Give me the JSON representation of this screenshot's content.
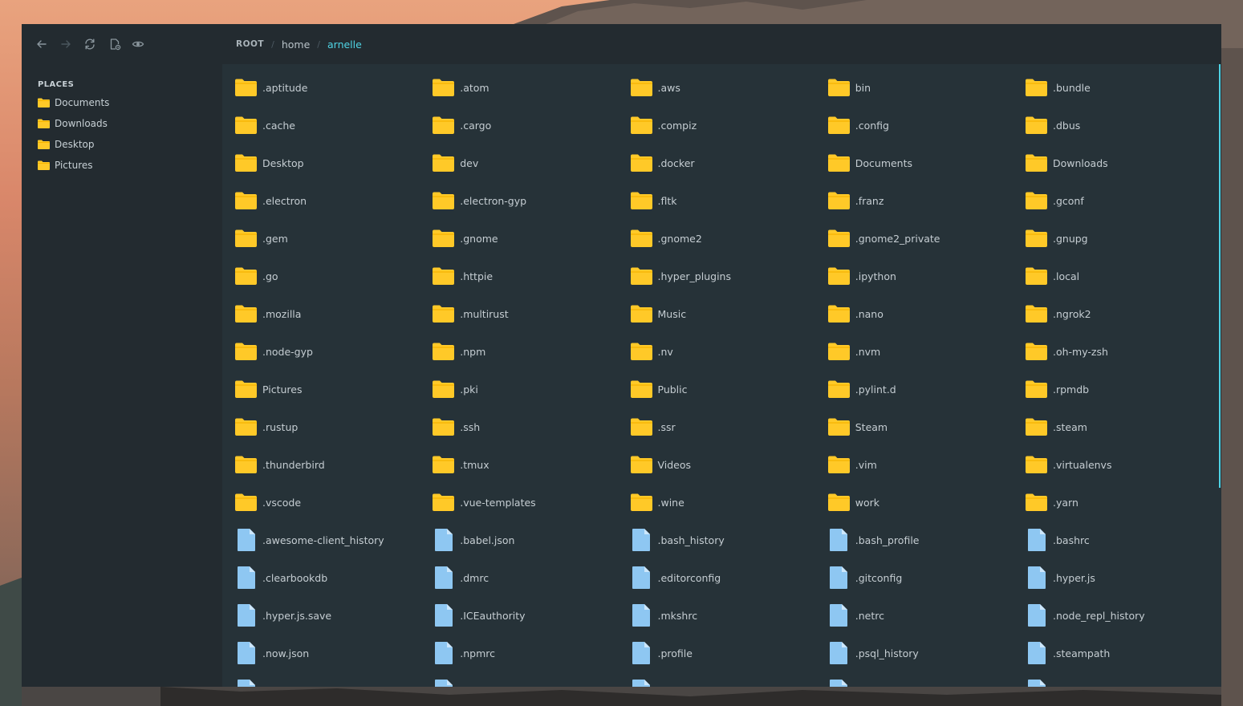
{
  "toolbar": {
    "buttons": [
      {
        "name": "back-button",
        "icon": "arrow-left-icon"
      },
      {
        "name": "forward-button",
        "icon": "arrow-right-icon"
      },
      {
        "name": "refresh-button",
        "icon": "refresh-icon"
      },
      {
        "name": "new-file-button",
        "icon": "new-file-icon"
      },
      {
        "name": "toggle-hidden-button",
        "icon": "eye-icon"
      }
    ]
  },
  "breadcrumb": {
    "root": "ROOT",
    "home": "home",
    "current": "arnelle"
  },
  "sidebar": {
    "title": "PLACES",
    "items": [
      {
        "label": "Documents"
      },
      {
        "label": "Downloads"
      },
      {
        "label": "Desktop"
      },
      {
        "label": "Pictures"
      }
    ]
  },
  "colors": {
    "folder": "#ffc928",
    "folder_tab": "#f5b300",
    "file": "#8ec7f2",
    "file_fold": "#cde7fb",
    "accent": "#4fd3e4",
    "panel_bg": "#263238",
    "sidebar_bg": "#232b30"
  },
  "items": [
    {
      "name": ".aptitude",
      "type": "folder"
    },
    {
      "name": ".atom",
      "type": "folder"
    },
    {
      "name": ".aws",
      "type": "folder"
    },
    {
      "name": "bin",
      "type": "folder"
    },
    {
      "name": ".bundle",
      "type": "folder"
    },
    {
      "name": ".cache",
      "type": "folder"
    },
    {
      "name": ".cargo",
      "type": "folder"
    },
    {
      "name": ".compiz",
      "type": "folder"
    },
    {
      "name": ".config",
      "type": "folder"
    },
    {
      "name": ".dbus",
      "type": "folder"
    },
    {
      "name": "Desktop",
      "type": "folder"
    },
    {
      "name": "dev",
      "type": "folder"
    },
    {
      "name": ".docker",
      "type": "folder"
    },
    {
      "name": "Documents",
      "type": "folder"
    },
    {
      "name": "Downloads",
      "type": "folder"
    },
    {
      "name": ".electron",
      "type": "folder"
    },
    {
      "name": ".electron-gyp",
      "type": "folder"
    },
    {
      "name": ".fltk",
      "type": "folder"
    },
    {
      "name": ".franz",
      "type": "folder"
    },
    {
      "name": ".gconf",
      "type": "folder"
    },
    {
      "name": ".gem",
      "type": "folder"
    },
    {
      "name": ".gnome",
      "type": "folder"
    },
    {
      "name": ".gnome2",
      "type": "folder"
    },
    {
      "name": ".gnome2_private",
      "type": "folder"
    },
    {
      "name": ".gnupg",
      "type": "folder"
    },
    {
      "name": ".go",
      "type": "folder"
    },
    {
      "name": ".httpie",
      "type": "folder"
    },
    {
      "name": ".hyper_plugins",
      "type": "folder"
    },
    {
      "name": ".ipython",
      "type": "folder"
    },
    {
      "name": ".local",
      "type": "folder"
    },
    {
      "name": ".mozilla",
      "type": "folder"
    },
    {
      "name": ".multirust",
      "type": "folder"
    },
    {
      "name": "Music",
      "type": "folder"
    },
    {
      "name": ".nano",
      "type": "folder"
    },
    {
      "name": ".ngrok2",
      "type": "folder"
    },
    {
      "name": ".node-gyp",
      "type": "folder"
    },
    {
      "name": ".npm",
      "type": "folder"
    },
    {
      "name": ".nv",
      "type": "folder"
    },
    {
      "name": ".nvm",
      "type": "folder"
    },
    {
      "name": ".oh-my-zsh",
      "type": "folder"
    },
    {
      "name": "Pictures",
      "type": "folder"
    },
    {
      "name": ".pki",
      "type": "folder"
    },
    {
      "name": "Public",
      "type": "folder"
    },
    {
      "name": ".pylint.d",
      "type": "folder"
    },
    {
      "name": ".rpmdb",
      "type": "folder"
    },
    {
      "name": ".rustup",
      "type": "folder"
    },
    {
      "name": ".ssh",
      "type": "folder"
    },
    {
      "name": ".ssr",
      "type": "folder"
    },
    {
      "name": "Steam",
      "type": "folder"
    },
    {
      "name": ".steam",
      "type": "folder"
    },
    {
      "name": ".thunderbird",
      "type": "folder"
    },
    {
      "name": ".tmux",
      "type": "folder"
    },
    {
      "name": "Videos",
      "type": "folder"
    },
    {
      "name": ".vim",
      "type": "folder"
    },
    {
      "name": ".virtualenvs",
      "type": "folder"
    },
    {
      "name": ".vscode",
      "type": "folder"
    },
    {
      "name": ".vue-templates",
      "type": "folder"
    },
    {
      "name": ".wine",
      "type": "folder"
    },
    {
      "name": "work",
      "type": "folder"
    },
    {
      "name": ".yarn",
      "type": "folder"
    },
    {
      "name": ".awesome-client_history",
      "type": "file"
    },
    {
      "name": ".babel.json",
      "type": "file"
    },
    {
      "name": ".bash_history",
      "type": "file"
    },
    {
      "name": ".bash_profile",
      "type": "file"
    },
    {
      "name": ".bashrc",
      "type": "file"
    },
    {
      "name": ".clearbookdb",
      "type": "file"
    },
    {
      "name": ".dmrc",
      "type": "file"
    },
    {
      "name": ".editorconfig",
      "type": "file"
    },
    {
      "name": ".gitconfig",
      "type": "file"
    },
    {
      "name": ".hyper.js",
      "type": "file"
    },
    {
      "name": ".hyper.js.save",
      "type": "file"
    },
    {
      "name": ".ICEauthority",
      "type": "file"
    },
    {
      "name": ".mkshrc",
      "type": "file"
    },
    {
      "name": ".netrc",
      "type": "file"
    },
    {
      "name": ".node_repl_history",
      "type": "file"
    },
    {
      "name": ".now.json",
      "type": "file"
    },
    {
      "name": ".npmrc",
      "type": "file"
    },
    {
      "name": ".profile",
      "type": "file"
    },
    {
      "name": ".psql_history",
      "type": "file"
    },
    {
      "name": ".steampath",
      "type": "file"
    },
    {
      "name": "",
      "type": "file"
    },
    {
      "name": "",
      "type": "file"
    },
    {
      "name": "",
      "type": "file"
    },
    {
      "name": "",
      "type": "file"
    },
    {
      "name": "",
      "type": "file"
    }
  ]
}
